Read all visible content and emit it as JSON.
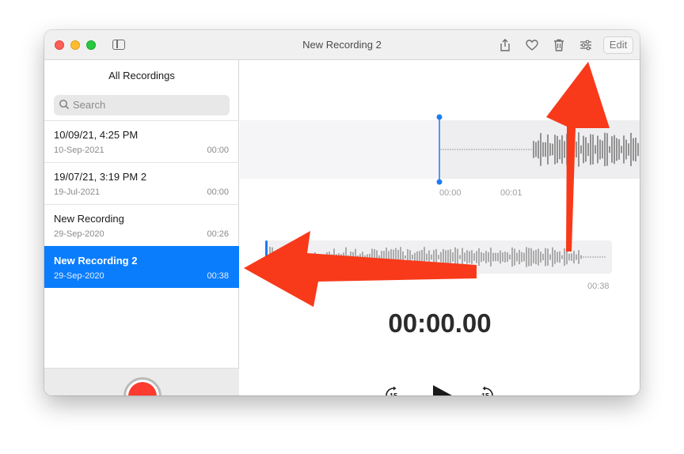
{
  "window": {
    "title": "New Recording 2",
    "edit_label": "Edit"
  },
  "toolbar": {
    "icons": [
      "share-icon",
      "heart-icon",
      "trash-icon",
      "settings-sliders-icon"
    ]
  },
  "sidebar": {
    "header": "All Recordings",
    "search_placeholder": "Search",
    "items": [
      {
        "name": "10/09/21, 4:25 PM",
        "date": "10-Sep-2021",
        "duration": "00:00"
      },
      {
        "name": "19/07/21, 3:19 PM 2",
        "date": "19-Jul-2021",
        "duration": "00:00"
      },
      {
        "name": "New Recording",
        "date": "29-Sep-2020",
        "duration": "00:26"
      },
      {
        "name": "New Recording 2",
        "date": "29-Sep-2020",
        "duration": "00:38"
      }
    ],
    "selected_index": 3
  },
  "player": {
    "timeline_ticks": [
      "00:00",
      "00:01"
    ],
    "mini_start": "0:",
    "mini_duration": "00:38",
    "current_time": "00:00.00",
    "skip_back_label": "15",
    "skip_forward_label": "15"
  },
  "colors": {
    "accent": "#0a7dfd",
    "record": "#fe3b30",
    "annotation_arrow": "#f83a1a"
  }
}
